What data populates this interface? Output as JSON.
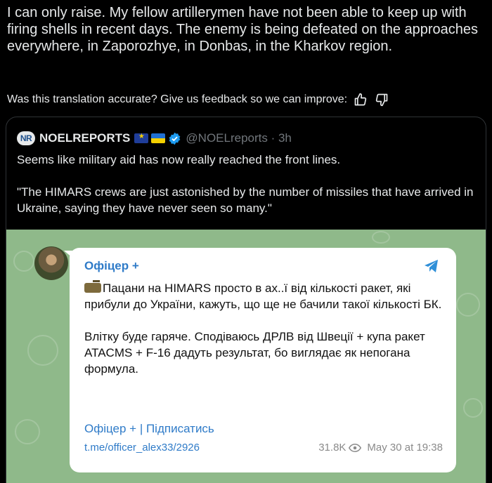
{
  "translation": {
    "text": "I can only raise. My fellow artillerymen have not been able to keep up with firing shells in recent days. The enemy is being defeated on the approaches everywhere, in Zaporozhye, in Donbas, in the Kharkov region.",
    "feedback_prompt": "Was this translation accurate? Give us feedback so we can improve:"
  },
  "quote_tweet": {
    "logo_text": "NR",
    "author_name": "NOELREPORTS",
    "handle_time": "@NOELreports · 3h",
    "paragraph1": "Seems like military aid has now really reached the front lines.",
    "paragraph2": "\"The HIMARS crews are just astonished by the number of missiles that have arrived in Ukraine, saying they have never seen so many.\""
  },
  "telegram_post": {
    "author": "Офіцер +",
    "paragraph1": "Пацани на HIMARS просто в ах..ї від кількості ракет, які прибули до України, кажуть, що ще не бачили такої кількості БК.",
    "paragraph2": "Влітку буде гаряче. Сподіваюсь ДРЛВ від Швеції + купа ракет ATACMS + F-16 дадуть результат, бо виглядає як непогана формула.",
    "links": "Офіцер + | Підписатись",
    "url": "t.me/officer_alex33/2926",
    "views": "31.8K",
    "date": "May 30 at 19:38"
  },
  "colors": {
    "background": "#000000",
    "telegram_link": "#2f7bc8",
    "telegram_wallpaper": "#8fb98a",
    "verified": "#1d9bf0"
  },
  "icons": [
    "thumbs-up-icon",
    "thumbs-down-icon",
    "verified-icon",
    "eu-flag-icon",
    "ukraine-flag-icon",
    "telegram-send-icon",
    "eye-icon",
    "tank-emoji-icon"
  ]
}
